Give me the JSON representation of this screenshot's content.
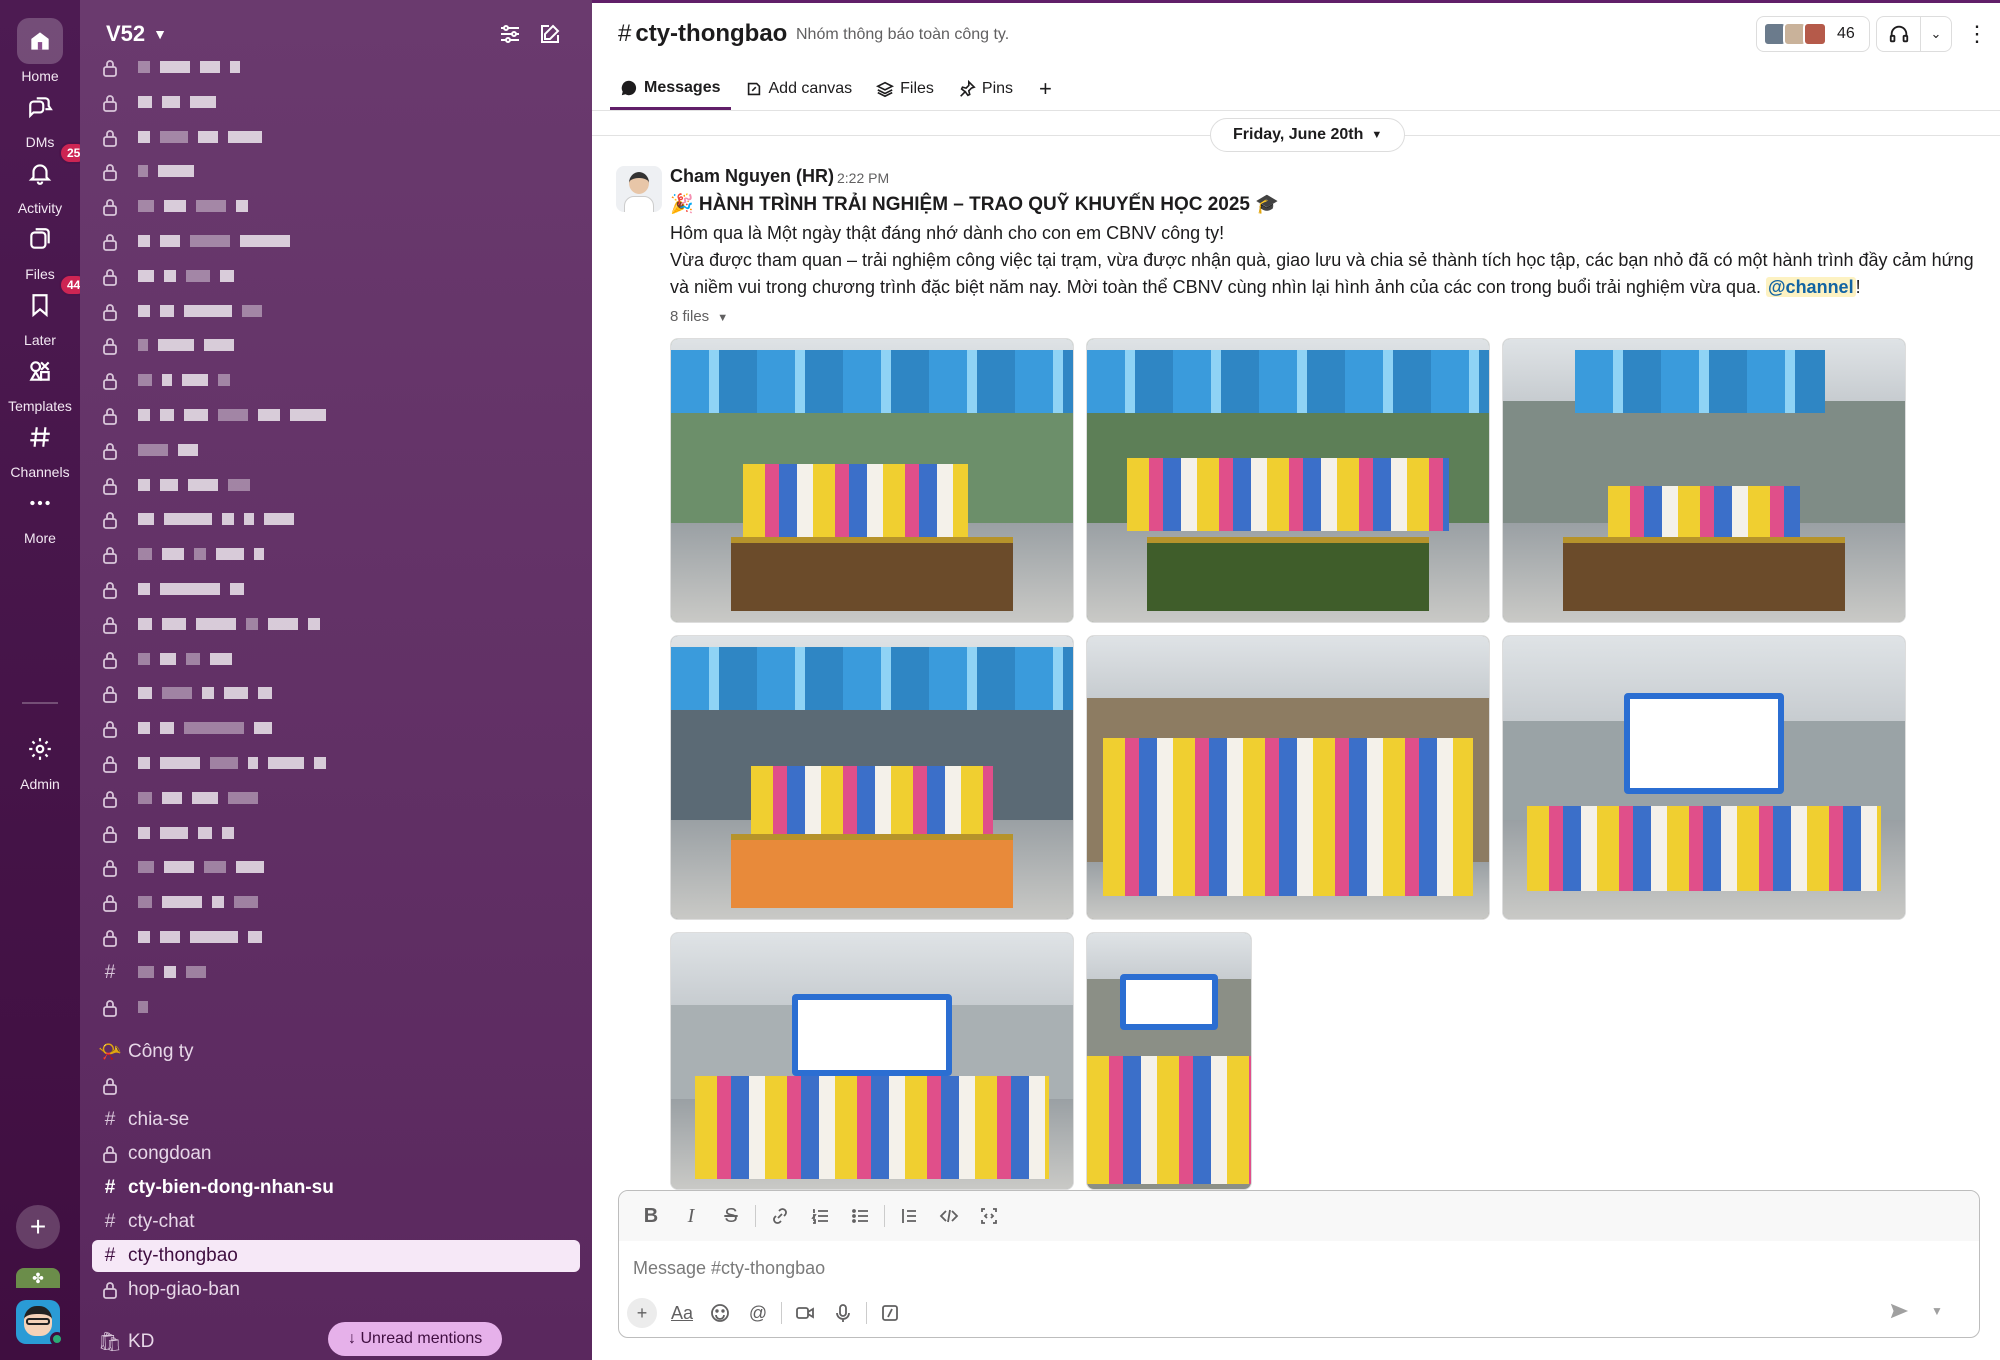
{
  "workspace": {
    "name": "V52"
  },
  "rail": {
    "items": [
      {
        "label": "Home"
      },
      {
        "label": "DMs"
      },
      {
        "label": "Activity",
        "badge": "25"
      },
      {
        "label": "Files"
      },
      {
        "label": "Later",
        "badge": "44"
      },
      {
        "label": "Templates"
      },
      {
        "label": "Channels"
      },
      {
        "label": "More"
      },
      {
        "label": "Admin"
      }
    ]
  },
  "sidebar": {
    "section_cong_ty": {
      "icon": "📯",
      "label": "Công ty"
    },
    "channels": [
      {
        "label": "chia-se"
      },
      {
        "label": "congdoan"
      },
      {
        "label": "cty-bien-dong-nhan-su"
      },
      {
        "label": "cty-chat"
      },
      {
        "label": "cty-thongbao"
      },
      {
        "label": "hop-giao-ban"
      }
    ],
    "section_kd": {
      "icon": "🛍",
      "label": "KD"
    },
    "unread_mentions": "↓ Unread mentions"
  },
  "channel": {
    "name": "cty-thongbao",
    "topic": "Nhóm thông báo toàn công ty.",
    "member_count": "46",
    "tabs": [
      {
        "label": "Messages"
      },
      {
        "label": "Add canvas"
      },
      {
        "label": "Files"
      },
      {
        "label": "Pins"
      }
    ],
    "date_divider": "Friday, June 20th"
  },
  "message": {
    "author": "Cham Nguyen (HR)",
    "time": "2:22 PM",
    "title": "🎉 HÀNH TRÌNH TRẢI NGHIỆM – TRAO QUỸ KHUYẾN HỌC 2025 🎓",
    "line1": "Hôm qua là Một ngày thật đáng nhớ dành cho con em CBNV công ty!",
    "line2": "Vừa được tham quan – trải nghiệm công việc tại trạm, vừa được nhận quà, giao lưu và chia sẻ thành tích học tập, các bạn nhỏ đã có một hành trình đầy cảm hứng và niềm vui trong chương trình đặc biệt năm nay. Mời toàn thể CBNV cùng nhìn lại hình ảnh của các con trong buổi trải nghiệm vừa qua. ",
    "mention": "@channel",
    "line2_end": "!",
    "files_label": "8 files"
  },
  "composer": {
    "placeholder": "Message #cty-thongbao"
  },
  "colors": {
    "rail_bg": "#3f0e40",
    "sidebar_bg": "#5c2c60",
    "accent": "#611f69",
    "badge": "#cd2553",
    "mention_bg": "#fdf2c2"
  }
}
